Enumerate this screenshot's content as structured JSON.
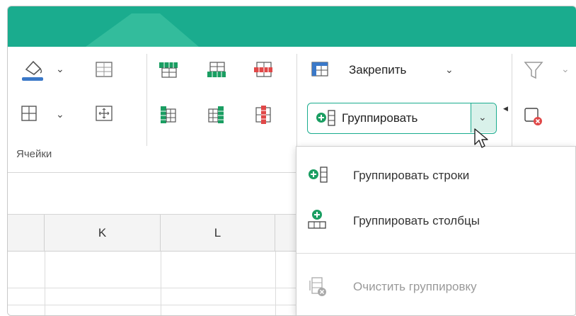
{
  "ribbon": {
    "cells_group_label": "Ячейки",
    "freeze_label": "Закрепить",
    "group_button_label": "Группировать"
  },
  "sheet": {
    "columns": [
      "K",
      "L"
    ]
  },
  "group_menu": {
    "items": [
      {
        "label": "Группировать строки",
        "icon": "group-rows-icon",
        "enabled": true
      },
      {
        "label": "Группировать столбцы",
        "icon": "group-columns-icon",
        "enabled": true
      },
      {
        "label": "Очистить группировку",
        "icon": "clear-grouping-icon",
        "enabled": false
      }
    ]
  },
  "colors": {
    "accent": "#1aac8e",
    "fill_underline": "#3a78c8",
    "red_icon": "#e04848",
    "green_icon": "#1a9e62"
  }
}
